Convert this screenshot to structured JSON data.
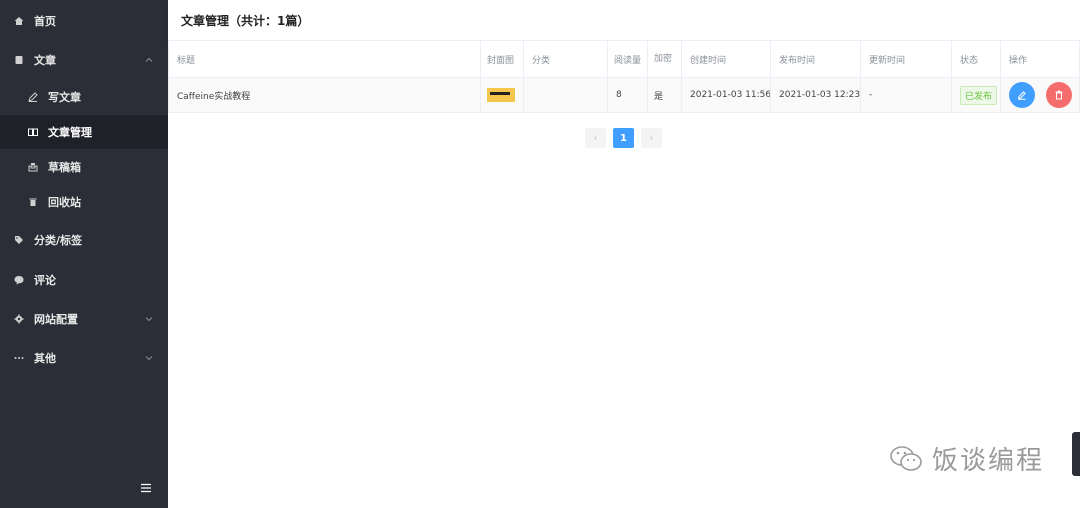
{
  "sidebar": {
    "items": [
      {
        "label": "首页",
        "icon": "home-icon"
      },
      {
        "label": "文章",
        "icon": "document-icon"
      },
      {
        "label": "写文章",
        "icon": "pen-icon"
      },
      {
        "label": "文章管理",
        "icon": "book-icon"
      },
      {
        "label": "草稿箱",
        "icon": "inbox-icon"
      },
      {
        "label": "回收站",
        "icon": "trash-icon"
      },
      {
        "label": "分类/标签",
        "icon": "tag-icon"
      },
      {
        "label": "评论",
        "icon": "comment-icon"
      },
      {
        "label": "网站配置",
        "icon": "gear-icon"
      },
      {
        "label": "其他",
        "icon": "more-icon"
      }
    ],
    "active_item": "文章管理"
  },
  "header": {
    "title": "文章管理（共计：1篇）"
  },
  "table": {
    "columns": [
      "标题",
      "封面图",
      "分类",
      "阅读量",
      "加密",
      "创建时间",
      "发布时间",
      "更新时间",
      "状态",
      "操作"
    ],
    "rows": [
      {
        "title": "Caffeine实战教程",
        "category": "",
        "views": "8",
        "encrypted": "是",
        "created": "2021-01-03 11:56",
        "published": "2021-01-03 12:23",
        "updated": "-",
        "status": "已发布"
      }
    ]
  },
  "pagination": {
    "prev": "‹",
    "current": "1",
    "next": "›"
  },
  "watermark": {
    "text": "饭谈编程"
  },
  "colors": {
    "sidebar_bg": "#2b2e36",
    "primary": "#409eff",
    "danger": "#f56c6c",
    "success": "#67c23a"
  }
}
